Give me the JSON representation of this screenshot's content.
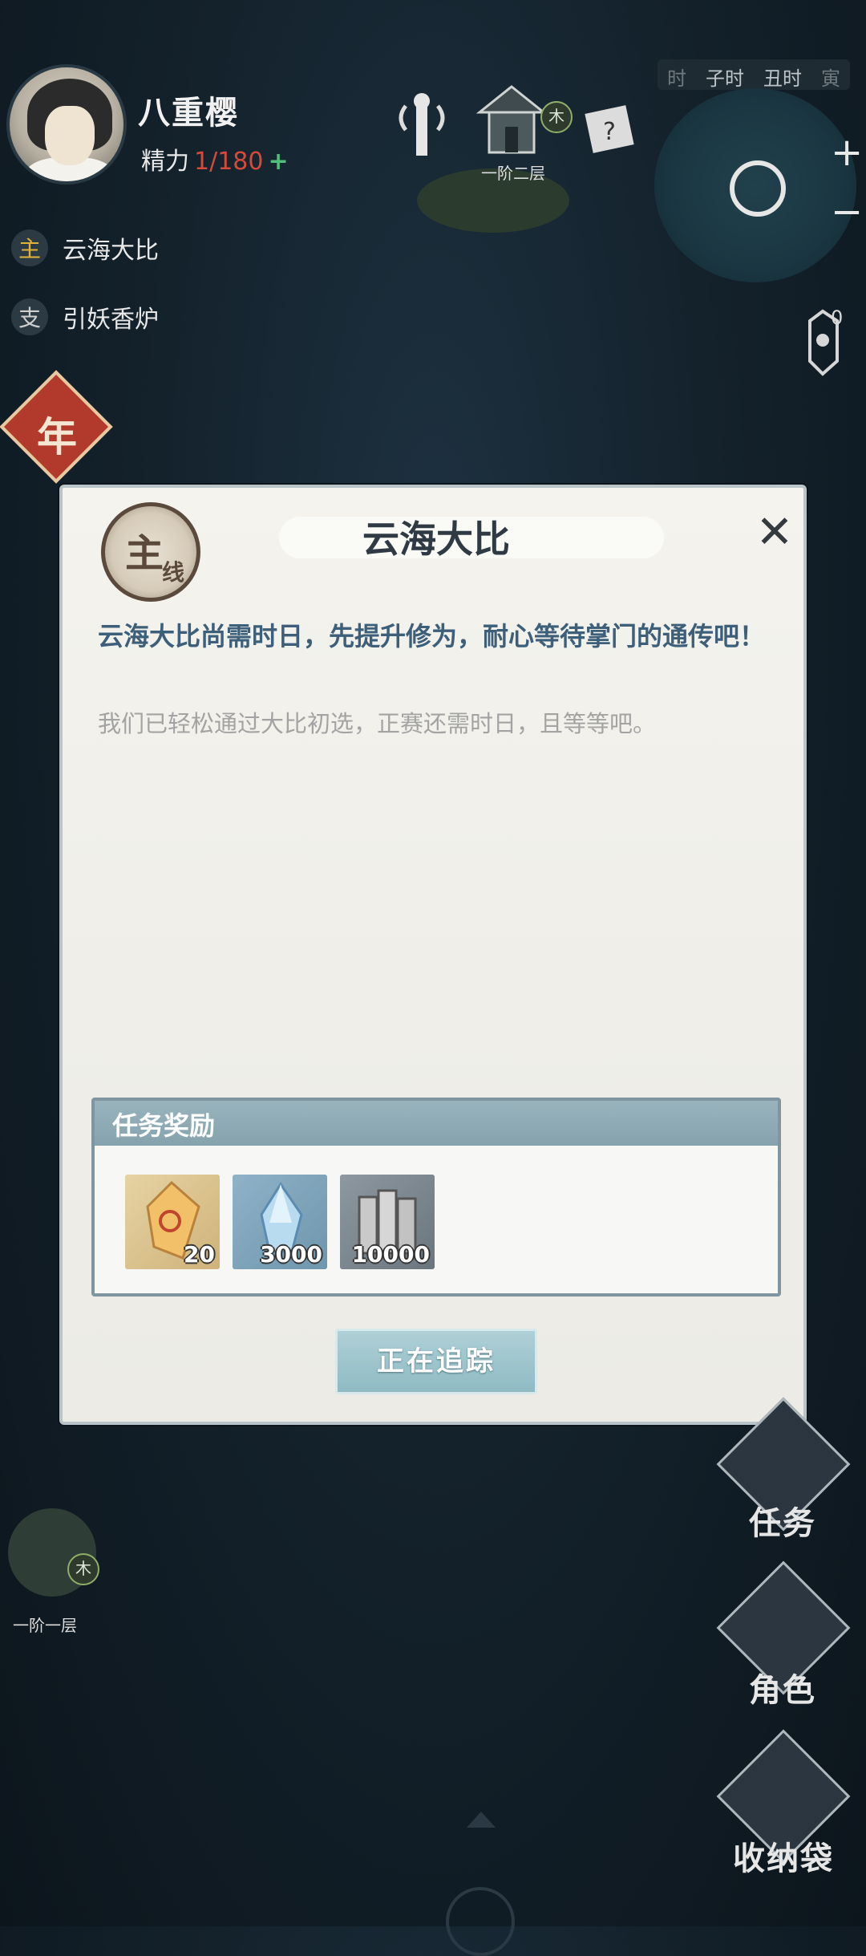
{
  "player": {
    "name": "八重樱",
    "stamina_label": "精力",
    "stamina_value": "1/180",
    "stamina_plus": "+"
  },
  "quest_tracker": [
    {
      "tag": "主",
      "name": "云海大比"
    },
    {
      "tag": "支",
      "name": "引妖香炉"
    }
  ],
  "year_badge": "年",
  "time_bar": [
    "时",
    "子时",
    "丑时",
    "寅"
  ],
  "minimap": {
    "zoom_in": "+",
    "zoom_out": "−"
  },
  "notice_count": "0",
  "map_nodes": [
    {
      "floor": "一阶二层",
      "element": "木"
    },
    {
      "floor": "一阶一层",
      "element": "木"
    }
  ],
  "dialog": {
    "seal_text": "主",
    "seal_sub": "线",
    "title": "云海大比",
    "close": "✕",
    "description": "云海大比尚需时日，先提升修为，耐心等待掌门的通传吧！",
    "sub_description": "我们已轻松通过大比初选，正赛还需时日，且等等吧。",
    "reward_title": "任务奖励",
    "rewards": [
      {
        "icon": "gold-crystal-icon",
        "qty": "20"
      },
      {
        "icon": "blue-spirit-stone-icon",
        "qty": "3000"
      },
      {
        "icon": "silver-coins-icon",
        "qty": "10000"
      }
    ],
    "track_button": "正在追踪"
  },
  "side_menu": [
    "任务",
    "角色",
    "收纳袋"
  ],
  "colors": {
    "accent_gold": "#e0b23a",
    "stamina_red": "#d64a3a",
    "plus_green": "#4ec07a",
    "desc_blue": "#3e5f7a",
    "button_teal": "#8fbac3"
  }
}
